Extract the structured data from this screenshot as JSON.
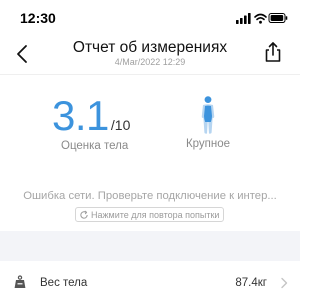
{
  "status_bar": {
    "time": "12:30"
  },
  "header": {
    "title": "Отчет об измерениях",
    "subtitle": "4/Mar/2022 12:29"
  },
  "score": {
    "value": "3.1",
    "max": "/10",
    "label": "Оценка тела"
  },
  "body_type": {
    "label": "Крупное"
  },
  "error": {
    "message": "Ошибка сети. Проверьте подключение к интер...",
    "retry_label": "Нажмите для повтора попытки"
  },
  "rows": [
    {
      "label": "Вес тела",
      "value": "87.4кг"
    }
  ],
  "colors": {
    "accent": "#3c93dd",
    "muted_text": "#8a8a8a",
    "band": "#f3f4f8"
  }
}
